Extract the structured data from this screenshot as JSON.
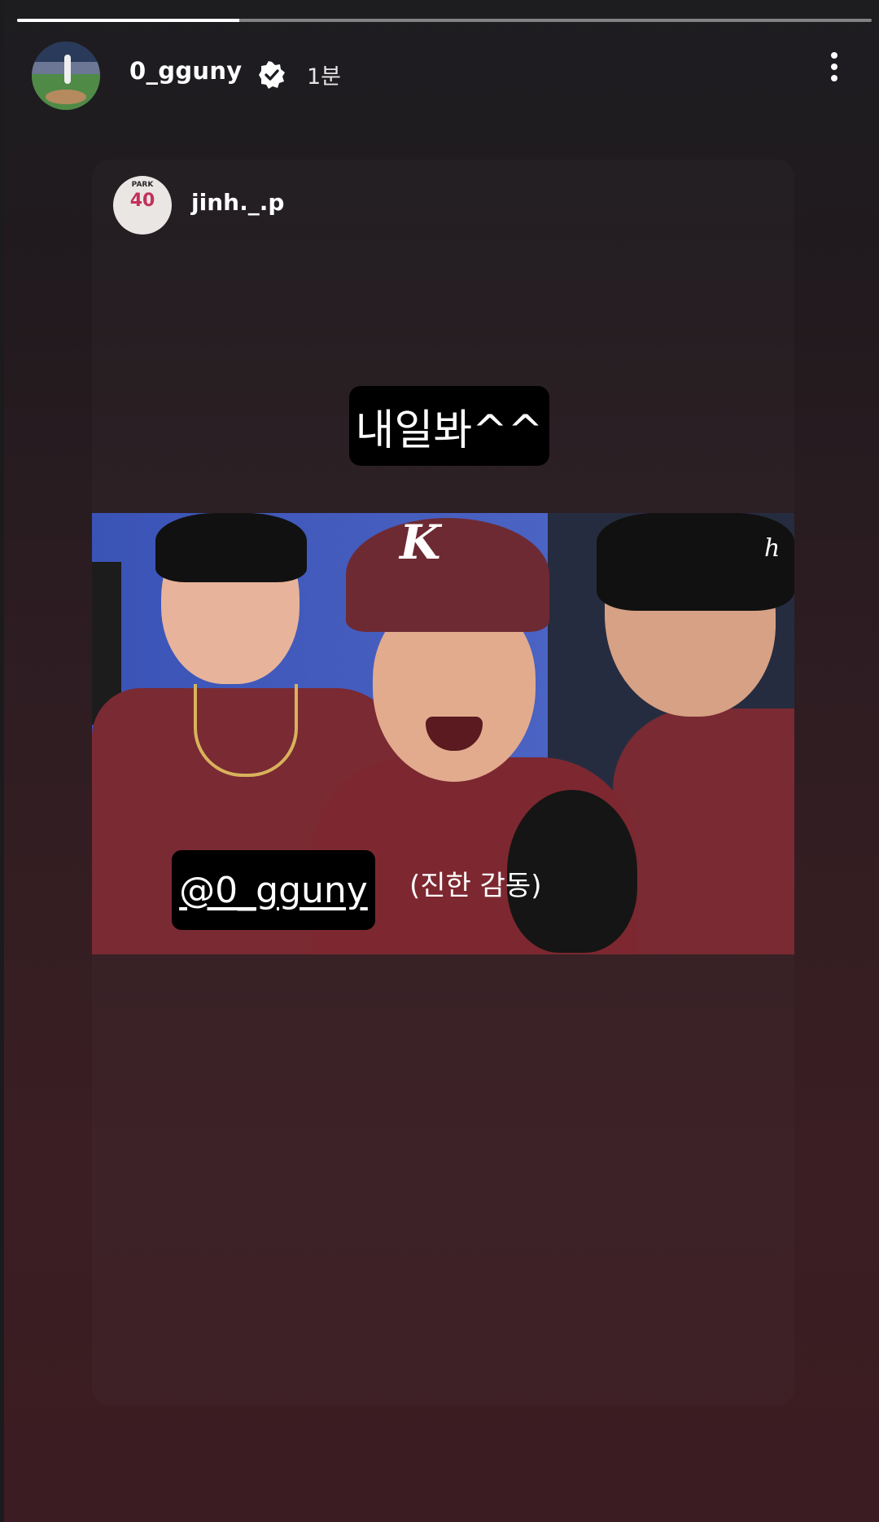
{
  "progress": {
    "fraction": 0.26
  },
  "header": {
    "username": "0_gguny",
    "time": "1분",
    "verified_icon": "verified-badge-icon",
    "more_icon": "more-vertical-icon"
  },
  "shared_post": {
    "username": "jinh._.p",
    "avatar_jersey_name": "PARK",
    "avatar_jersey_number": "40",
    "text_sticker": "내일봐^^",
    "mention_sticker": "@0_gguny",
    "caption": "(진한 감동)",
    "photo_watermark": "h"
  },
  "colors": {
    "background_top": "#1d1d20",
    "background_bottom": "#3b1c22",
    "sticker_bg": "#000000",
    "jersey": "#7a2a33"
  }
}
